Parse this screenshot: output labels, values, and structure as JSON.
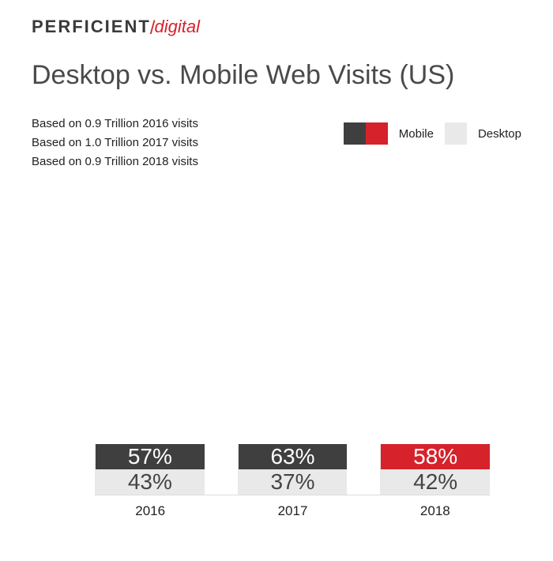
{
  "logo": {
    "perficient": "PERFICIENT",
    "digital": "digital"
  },
  "title": "Desktop vs. Mobile Web Visits (US)",
  "notes": [
    "Based on 0.9 Trillion 2016 visits",
    "Based on 1.0 Trillion 2017 visits",
    "Based on 0.9 Trillion 2018 visits"
  ],
  "legend": {
    "mobile": "Mobile",
    "desktop": "Desktop"
  },
  "colors": {
    "mobile_dark": "#3f3f3f",
    "mobile_red": "#d6222b",
    "desktop": "#e9e9e9"
  },
  "chart_data": {
    "type": "bar",
    "stacked": true,
    "title": "Desktop vs. Mobile Web Visits (US)",
    "xlabel": "",
    "ylabel": "",
    "unit": "percent",
    "categories": [
      "2016",
      "2017",
      "2018"
    ],
    "series": [
      {
        "name": "Mobile",
        "values": [
          57,
          63,
          58
        ],
        "colors": [
          "#3f3f3f",
          "#3f3f3f",
          "#d6222b"
        ]
      },
      {
        "name": "Desktop",
        "values": [
          43,
          37,
          42
        ],
        "colors": [
          "#e9e9e9",
          "#e9e9e9",
          "#e9e9e9"
        ]
      }
    ],
    "bar_heights_relative": [
      0.87,
      1.0,
      0.87
    ],
    "ylim": [
      0,
      100
    ]
  },
  "labels": {
    "2016": {
      "mobile": "57%",
      "desktop": "43%"
    },
    "2017": {
      "mobile": "63%",
      "desktop": "37%"
    },
    "2018": {
      "mobile": "58%",
      "desktop": "42%"
    }
  }
}
